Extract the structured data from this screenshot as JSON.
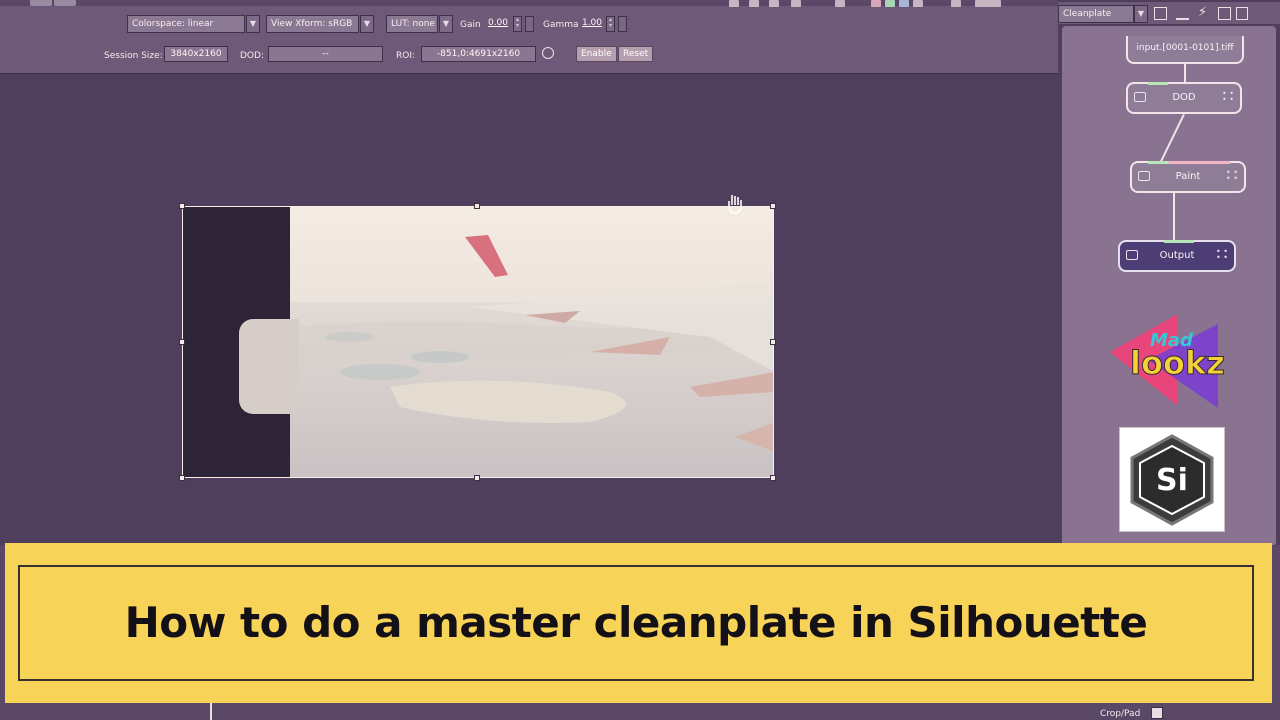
{
  "toolbar": {
    "colorspace_label": "Colorspace: linear",
    "view_xform_label": "View Xform: sRGB",
    "lut_label": "LUT: none",
    "gain_label": "Gain",
    "gain_value": "0.00",
    "gamma_label": "Gamma",
    "gamma_value": "1.00",
    "session_size_label": "Session Size:",
    "session_size_value": "3840x2160",
    "dod_label": "DOD:",
    "dod_value": "--",
    "roi_label": "ROI:",
    "roi_value": "-851,0:4691x2160",
    "enable_label": "Enable",
    "reset_label": "Reset",
    "dropdown_arrow": "▼"
  },
  "node_panel": {
    "preset_label": "Cleanplate",
    "nodes": [
      {
        "label": "input.[0001-0101].tiff"
      },
      {
        "label": "DOD"
      },
      {
        "label": "Paint"
      },
      {
        "label": "Output"
      }
    ]
  },
  "logos": {
    "madlookz_top": "Mad",
    "madlookz_main": "lookz",
    "silhouette": "Si"
  },
  "banner": {
    "title": "How to do a master cleanplate in Silhouette",
    "background": "#f7d457"
  },
  "bottom_panel": {
    "crop_label": "Crop/Pad"
  }
}
